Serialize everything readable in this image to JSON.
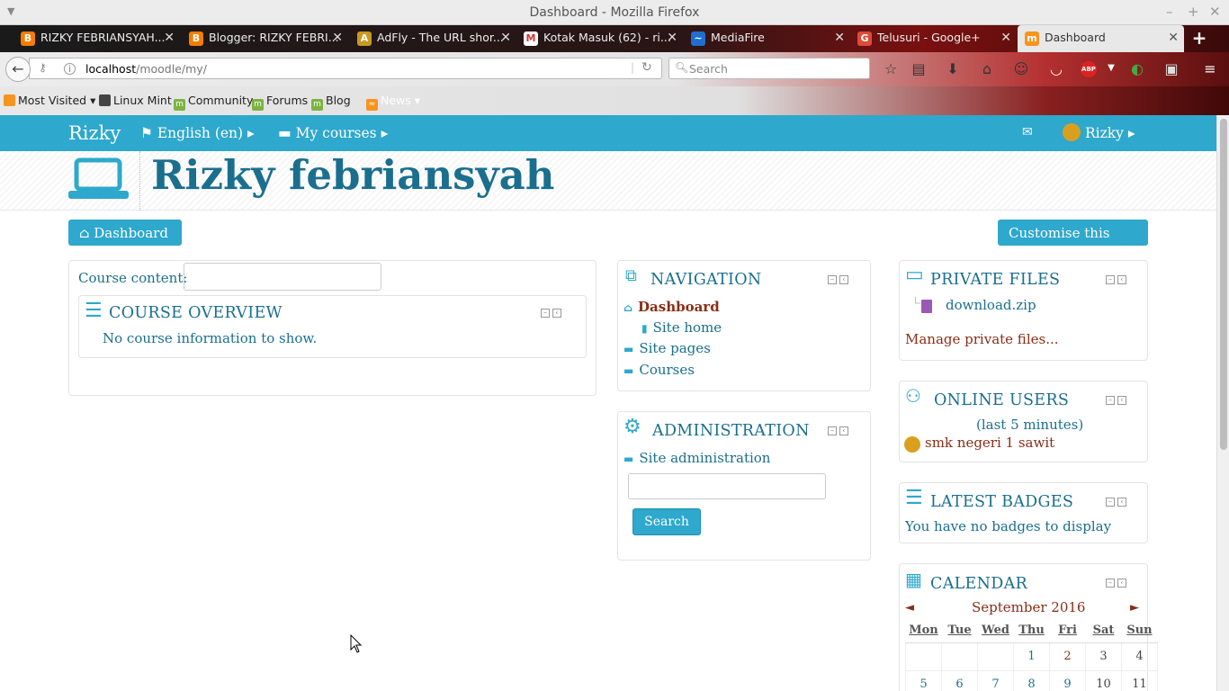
{
  "window": {
    "title": "Dashboard - Mozilla Firefox"
  },
  "tabs": [
    {
      "label": "RIZKY FEBRIANSYAH...",
      "icon": "blogger-icon"
    },
    {
      "label": "Blogger: RIZKY FEBRI...",
      "icon": "blogger-icon"
    },
    {
      "label": "AdFly - The URL shor...",
      "icon": "adfly-icon"
    },
    {
      "label": "Kotak Masuk (62) - ri...",
      "icon": "gmail-icon"
    },
    {
      "label": "MediaFire",
      "icon": "mediafire-icon"
    },
    {
      "label": "Telusuri - Google+",
      "icon": "googleplus-icon"
    },
    {
      "label": "Dashboard",
      "icon": "moodle-icon",
      "active": true
    }
  ],
  "toolbar": {
    "url_host": "localhost",
    "url_path": "/moodle/my/",
    "search_placeholder": "Search"
  },
  "bookmarks": [
    "Most Visited",
    "Linux Mint",
    "Community",
    "Forums",
    "Blog",
    "News"
  ],
  "moodle": {
    "brand": "Rizky",
    "language": "English (en)",
    "my_courses": "My courses",
    "user": "Rizky",
    "page_heading": "Rizky febriansyah",
    "dashboard_button": "Dashboard",
    "customise_button": "Customise this page",
    "course_content_label": "Course content:",
    "course_overview": {
      "title": "COURSE OVERVIEW",
      "empty": "No course information to show."
    },
    "navigation": {
      "title": "NAVIGATION",
      "items": [
        "Dashboard",
        "Site home",
        "Site pages",
        "Courses"
      ]
    },
    "administration": {
      "title": "ADMINISTRATION",
      "item": "Site administration",
      "search_button": "Search"
    },
    "private_files": {
      "title": "PRIVATE FILES",
      "file": "download.zip",
      "manage": "Manage private files..."
    },
    "online_users": {
      "title": "ONLINE USERS",
      "period": "(last 5 minutes)",
      "users": [
        "smk negeri 1 sawit"
      ]
    },
    "latest_badges": {
      "title": "LATEST BADGES",
      "empty": "You have no badges to display"
    },
    "calendar": {
      "title": "CALENDAR",
      "month": "September 2016",
      "prev": "◄",
      "next": "►",
      "days": [
        "Mon",
        "Tue",
        "Wed",
        "Thu",
        "Fri",
        "Sat",
        "Sun"
      ],
      "weeks": [
        [
          "",
          "",
          "",
          "1",
          "2",
          "3",
          "4"
        ],
        [
          "5",
          "6",
          "7",
          "8",
          "9",
          "10",
          "11"
        ]
      ]
    }
  },
  "colors": {
    "accent": "#2ea8cc",
    "heading": "#1a6f8e",
    "link_dark": "#8a2d16"
  }
}
